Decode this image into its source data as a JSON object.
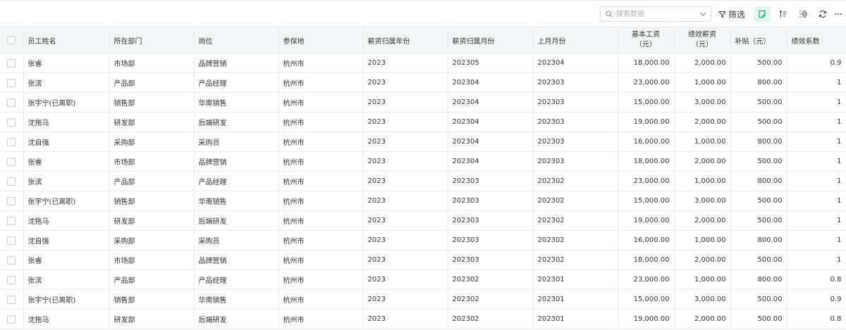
{
  "toolbar": {
    "search_placeholder": "搜索数据",
    "filter_label": "筛选"
  },
  "table": {
    "columns": [
      {
        "label": "员工姓名"
      },
      {
        "label": "所在部门"
      },
      {
        "label": "岗位"
      },
      {
        "label": "参保地"
      },
      {
        "label": "薪资归属年份"
      },
      {
        "label": "薪资归属月份"
      },
      {
        "label": "上月月份"
      },
      {
        "line1": "基本工资",
        "line2": "（元）"
      },
      {
        "line1": "绩效薪资",
        "line2": "（元）"
      },
      {
        "label": "补贴（元）"
      },
      {
        "label": "绩效系数"
      }
    ],
    "rows": [
      {
        "name": "张睿",
        "dept": "市场部",
        "post": "品牌营销",
        "city": "杭州市",
        "year": "2023",
        "month": "202305",
        "prev": "202304",
        "base": "18,000.00",
        "perf": "2,000.00",
        "sub": "500.00",
        "coef": "0.9"
      },
      {
        "name": "张滨",
        "dept": "产品部",
        "post": "产品经理",
        "city": "杭州市",
        "year": "2023",
        "month": "202304",
        "prev": "202303",
        "base": "23,000.00",
        "perf": "1,000.00",
        "sub": "800.00",
        "coef": "1"
      },
      {
        "name": "张宇宁(已离职)",
        "dept": "销售部",
        "post": "华南销售",
        "city": "杭州市",
        "year": "2023",
        "month": "202304",
        "prev": "202303",
        "base": "15,000.00",
        "perf": "3,000.00",
        "sub": "500.00",
        "coef": "1"
      },
      {
        "name": "沈拖马",
        "dept": "研发部",
        "post": "后端研发",
        "city": "杭州市",
        "year": "2023",
        "month": "202304",
        "prev": "202303",
        "base": "19,000.00",
        "perf": "2,000.00",
        "sub": "500.00",
        "coef": "1"
      },
      {
        "name": "沈自强",
        "dept": "采购部",
        "post": "采购员",
        "city": "杭州市",
        "year": "2023",
        "month": "202304",
        "prev": "202303",
        "base": "16,000.00",
        "perf": "1,000.00",
        "sub": "800.00",
        "coef": "1"
      },
      {
        "name": "张睿",
        "dept": "市场部",
        "post": "品牌营销",
        "city": "杭州市",
        "year": "2023",
        "month": "202304",
        "prev": "202303",
        "base": "18,000.00",
        "perf": "2,000.00",
        "sub": "500.00",
        "coef": "1"
      },
      {
        "name": "张滨",
        "dept": "产品部",
        "post": "产品经理",
        "city": "杭州市",
        "year": "2023",
        "month": "202303",
        "prev": "202302",
        "base": "23,000.00",
        "perf": "1,000.00",
        "sub": "800.00",
        "coef": "1"
      },
      {
        "name": "张宇宁(已离职)",
        "dept": "销售部",
        "post": "华南销售",
        "city": "杭州市",
        "year": "2023",
        "month": "202303",
        "prev": "202302",
        "base": "15,000.00",
        "perf": "3,000.00",
        "sub": "500.00",
        "coef": "1"
      },
      {
        "name": "沈拖马",
        "dept": "研发部",
        "post": "后端研发",
        "city": "杭州市",
        "year": "2023",
        "month": "202303",
        "prev": "202302",
        "base": "19,000.00",
        "perf": "2,000.00",
        "sub": "500.00",
        "coef": "1"
      },
      {
        "name": "沈自强",
        "dept": "采购部",
        "post": "采购员",
        "city": "杭州市",
        "year": "2023",
        "month": "202303",
        "prev": "202302",
        "base": "16,000.00",
        "perf": "1,000.00",
        "sub": "800.00",
        "coef": "1"
      },
      {
        "name": "张睿",
        "dept": "市场部",
        "post": "品牌营销",
        "city": "杭州市",
        "year": "2023",
        "month": "202303",
        "prev": "202302",
        "base": "18,000.00",
        "perf": "2,000.00",
        "sub": "500.00",
        "coef": "1"
      },
      {
        "name": "张滨",
        "dept": "产品部",
        "post": "产品经理",
        "city": "杭州市",
        "year": "2023",
        "month": "202302",
        "prev": "202301",
        "base": "23,000.00",
        "perf": "1,000.00",
        "sub": "800.00",
        "coef": "0.8"
      },
      {
        "name": "张宇宁(已离职)",
        "dept": "销售部",
        "post": "华南销售",
        "city": "杭州市",
        "year": "2023",
        "month": "202302",
        "prev": "202301",
        "base": "15,000.00",
        "perf": "3,000.00",
        "sub": "500.00",
        "coef": "0.9"
      },
      {
        "name": "沈拖马",
        "dept": "研发部",
        "post": "后端研发",
        "city": "杭州市",
        "year": "2023",
        "month": "202302",
        "prev": "202301",
        "base": "19,000.00",
        "perf": "2,000.00",
        "sub": "500.00",
        "coef": "0.8"
      }
    ]
  },
  "icons": {
    "search": "search-icon",
    "dropdown": "chevron-down-icon",
    "filter": "filter-icon",
    "active_view": "note-icon",
    "sort": "sort-icon",
    "group": "group-icon",
    "refresh": "refresh-icon",
    "more": "more-icon"
  },
  "colors": {
    "accent": "#1aa872",
    "active_bg": "#e3f6ef",
    "header_bg": "#f5f6f7",
    "grid": "#ececec"
  }
}
